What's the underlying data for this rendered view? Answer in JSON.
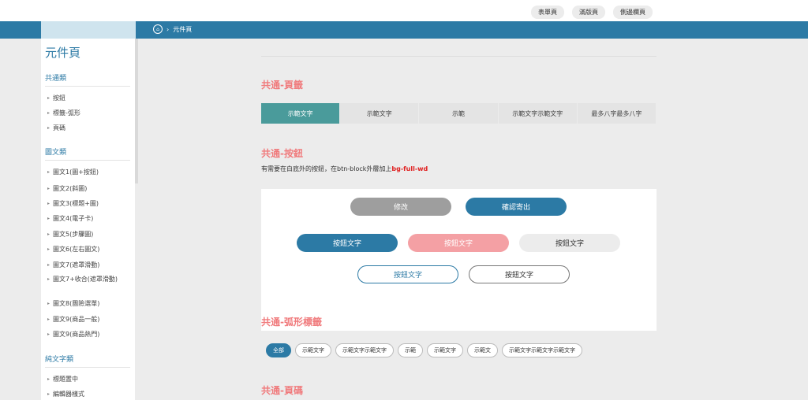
{
  "top_links": [
    "表單頁",
    "滿版頁",
    "側邊欄頁"
  ],
  "breadcrumb": {
    "current": "元件頁"
  },
  "sidebar": {
    "title": "元件頁",
    "sections": [
      {
        "title": "共通類",
        "items": [
          "按鈕",
          "標籤-弧形",
          "頁碼"
        ]
      },
      {
        "title": "圖文類",
        "items": [
          "圖文1(圖+按鈕)",
          "圖文2(斜圖)",
          "圖文3(標題+圖)",
          "圖文4(電子卡)",
          "圖文5(步驟圖)",
          "圖文6(左右圖文)",
          "圖文7(遮罩滑動)",
          "圖文7+收合(遮罩滑動)",
          "圖文8(團險選單)",
          "圖文9(商品一般)",
          "圖文9(商品熱門)"
        ]
      },
      {
        "title": "純文字類",
        "items": [
          "標題置中",
          "編輯器樣式"
        ]
      }
    ]
  },
  "main": {
    "tabs_section": {
      "title": "共通-頁籤",
      "tabs": [
        "示範文字",
        "示範文字",
        "示範",
        "示範文字示範文字",
        "最多八字最多八字"
      ]
    },
    "buttons_section": {
      "title": "共通-按鈕",
      "note_prefix": "有需要在白底外的按鈕，在btn-block外層加上",
      "note_code": "bg-full-wd",
      "buttons": [
        "修改",
        "確認寄出",
        "按鈕文字",
        "按鈕文字",
        "按鈕文字",
        "按鈕文字",
        "按鈕文字"
      ]
    },
    "tags_section": {
      "title": "共通-弧形標籤",
      "tags": [
        "全部",
        "示範文字",
        "示範文字示範文字",
        "示範",
        "示範文字",
        "示範文",
        "示範文字示範文字示範文字"
      ]
    },
    "pagination_section": {
      "title": "共通-頁碼"
    }
  },
  "colors": {
    "primary": "#2c7aa5",
    "teal": "#4a9b9b",
    "accent": "#f07a7c",
    "pink": "#f4a0a4",
    "gray": "#9e9e9e"
  }
}
